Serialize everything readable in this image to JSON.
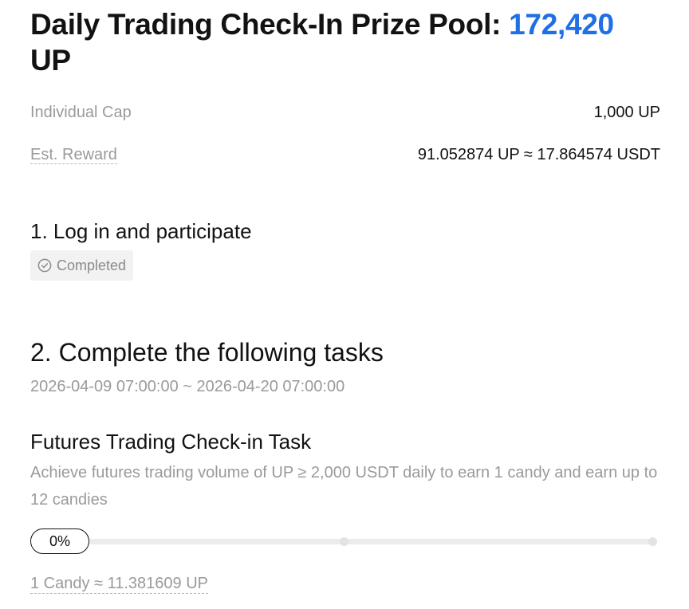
{
  "header": {
    "title_prefix": "Daily Trading Check-In Prize Pool: ",
    "pool_amount": "172,420",
    "pool_unit": "UP"
  },
  "stats": {
    "individual_cap_label": "Individual Cap",
    "individual_cap_value": "1,000 UP",
    "est_reward_label": "Est. Reward",
    "est_reward_value": "91.052874 UP ≈ 17.864574 USDT"
  },
  "step1": {
    "title": "1. Log in and participate",
    "status_icon": "check-circle-icon",
    "status": "Completed"
  },
  "step2": {
    "title": "2. Complete the following tasks",
    "period": "2026-04-09 07:00:00 ~ 2026-04-20 07:00:00"
  },
  "task": {
    "title": "Futures Trading Check-in Task",
    "description": "Achieve futures trading volume of UP ≥ 2,000 USDT daily to earn 1 candy and earn up to 12 candies",
    "progress_label": "0%",
    "progress_fraction": 0,
    "candy_rate": "1 Candy ≈ 11.381609 UP"
  },
  "colors": {
    "accent": "#1f6fe5",
    "muted_text": "#9a9a9a",
    "primary_text": "#121212"
  }
}
